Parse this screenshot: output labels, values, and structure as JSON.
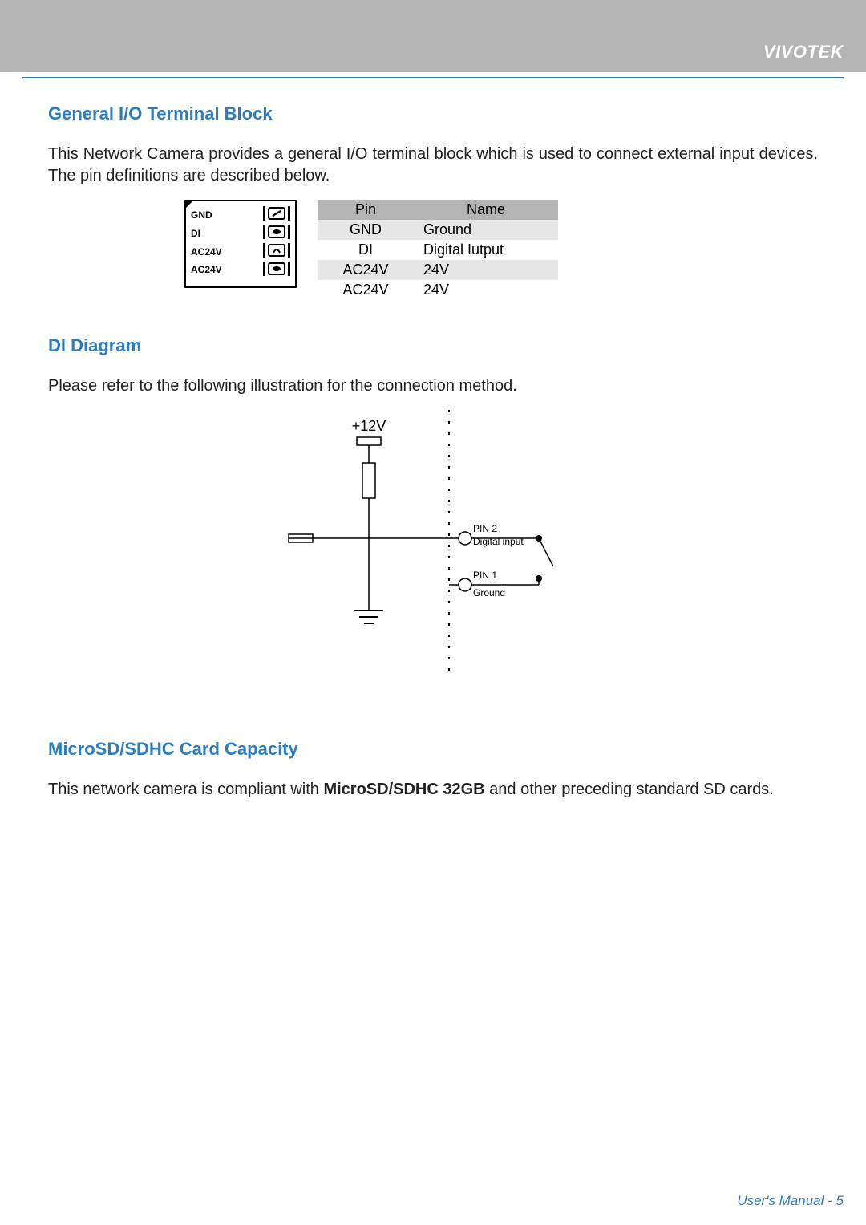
{
  "header": {
    "brand": "VIVOTEK"
  },
  "section1": {
    "title": "General I/O Terminal Block",
    "text": "This Network Camera provides a general I/O terminal block which is used to connect external input devices. The pin definitions are described below.",
    "terminal_labels": [
      "GND",
      "DI",
      "AC24V",
      "AC24V"
    ],
    "table": {
      "headers": [
        "Pin",
        "Name"
      ],
      "rows": [
        {
          "pin": "GND",
          "name": "Ground"
        },
        {
          "pin": "DI",
          "name": "Digital Iutput"
        },
        {
          "pin": "AC24V",
          "name": "24V"
        },
        {
          "pin": "AC24V",
          "name": "24V"
        }
      ]
    }
  },
  "section2": {
    "title": "DI Diagram",
    "text": "Please refer to the following illustration for the connection method.",
    "labels": {
      "v12": "+12V",
      "pin2": "PIN 2",
      "digital_input": "Digital input",
      "pin1": "PIN 1",
      "ground": "Ground"
    }
  },
  "section3": {
    "title": "MicroSD/SDHC Card Capacity",
    "text_pre": "This network camera is compliant with ",
    "text_bold": "MicroSD/SDHC 32GB",
    "text_post": " and other preceding standard SD cards."
  },
  "footer": {
    "text": "User's Manual - 5"
  }
}
